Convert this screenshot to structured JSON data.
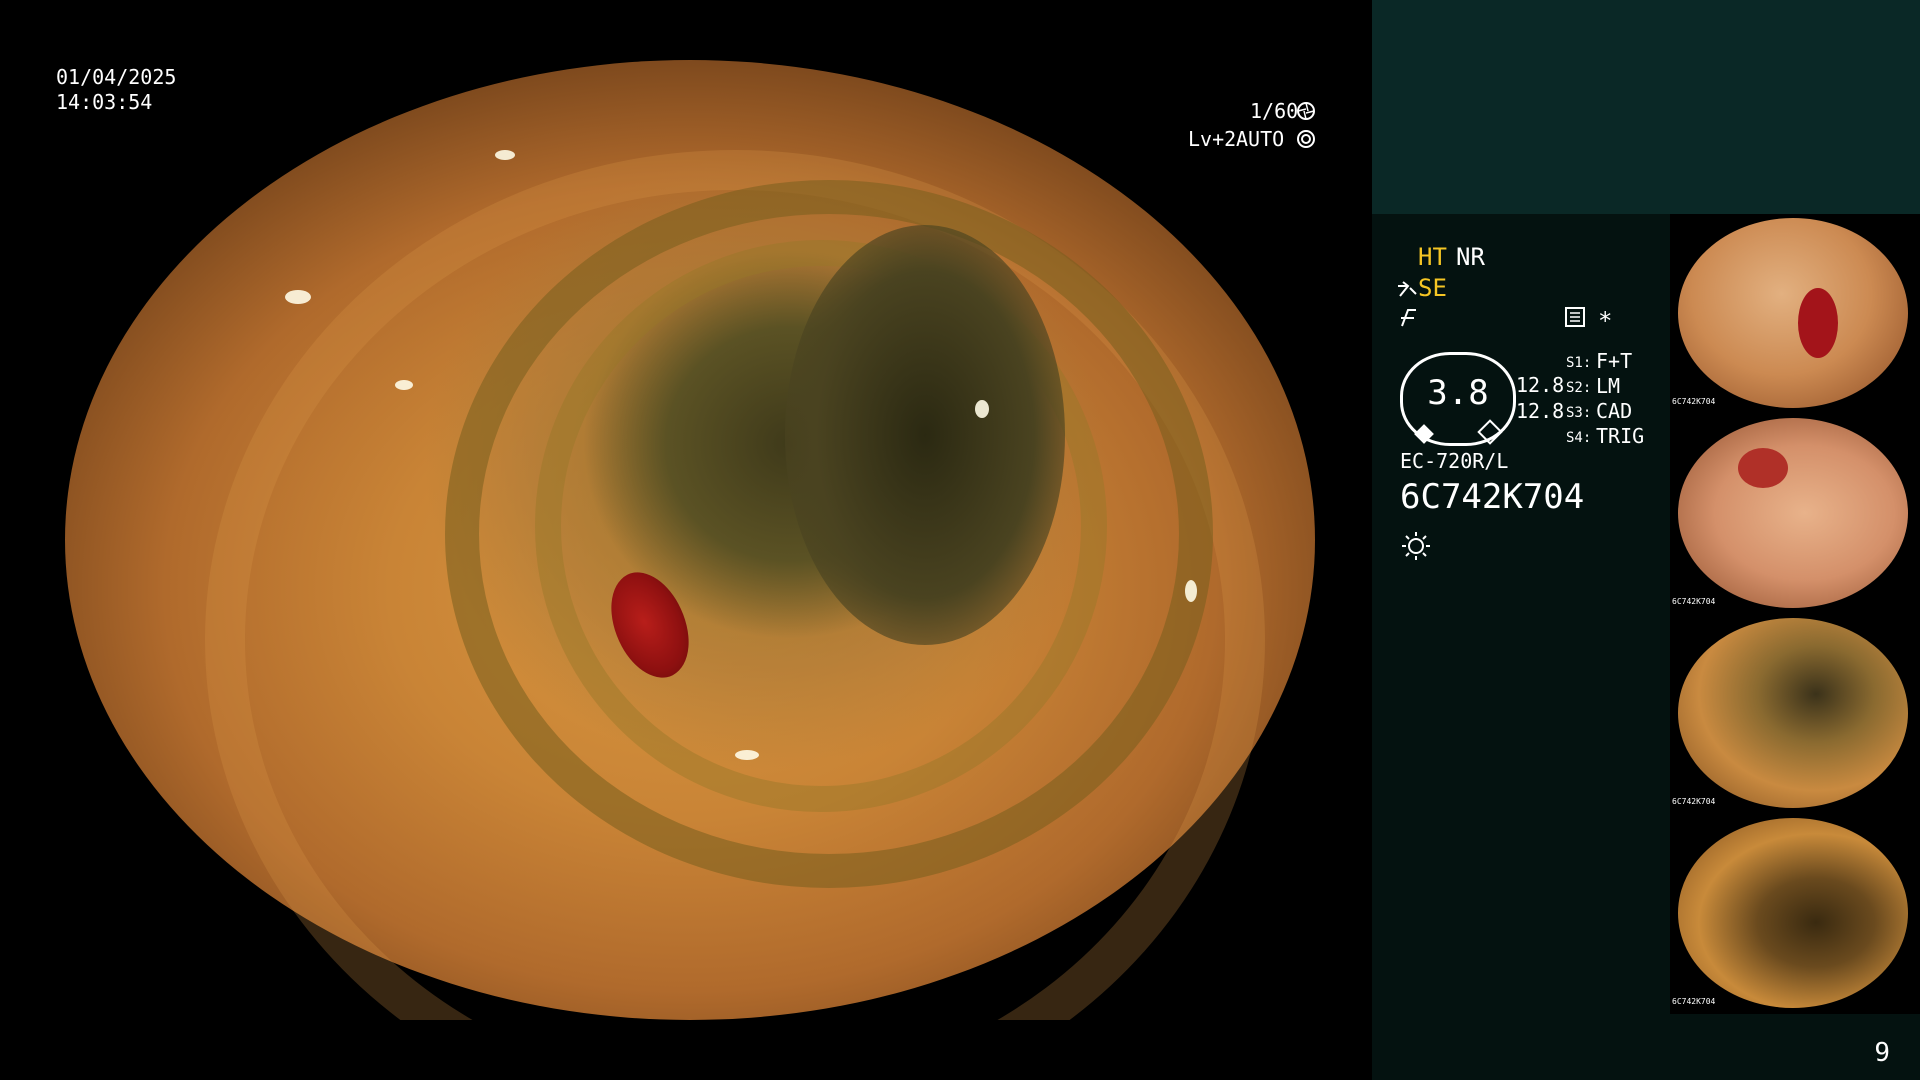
{
  "overlay": {
    "date": "01/04/2025",
    "time": "14:03:54",
    "shutter": "1/60",
    "level": "Lv+2",
    "iris": "AUTO"
  },
  "settings": {
    "ht": "HT",
    "nr": "NR",
    "se": "SE",
    "gauge_value": "3.8",
    "readout_1": "12.8",
    "readout_2": "12.8",
    "s1_key": "S1:",
    "s1_val": "F+T",
    "s2_key": "S2:",
    "s2_val": "LM",
    "s3_key": "S3:",
    "s3_val": "CAD",
    "s4_key": "S4:",
    "s4_val": "TRIG",
    "model": "EC-720R/L",
    "serial": "6C742K704",
    "asterisk": "*"
  },
  "thumbnails": [
    {
      "label": "6C742K704"
    },
    {
      "label": "6C742K704"
    },
    {
      "label": "6C742K704"
    },
    {
      "label": "6C742K704"
    }
  ],
  "page_number": "9",
  "icons": {
    "shutter_icon": "aperture-icon",
    "iris_icon": "iris-icon",
    "se_icon": "structure-enhance-icon",
    "color_icon": "color-adjust-icon",
    "memory_icon": "memory-icon",
    "light_icon": "light-source-icon"
  },
  "colors": {
    "accent_amber": "#f5c524",
    "sidebar_bg": "#041210",
    "sidebar_top_bg": "#0a2826"
  }
}
